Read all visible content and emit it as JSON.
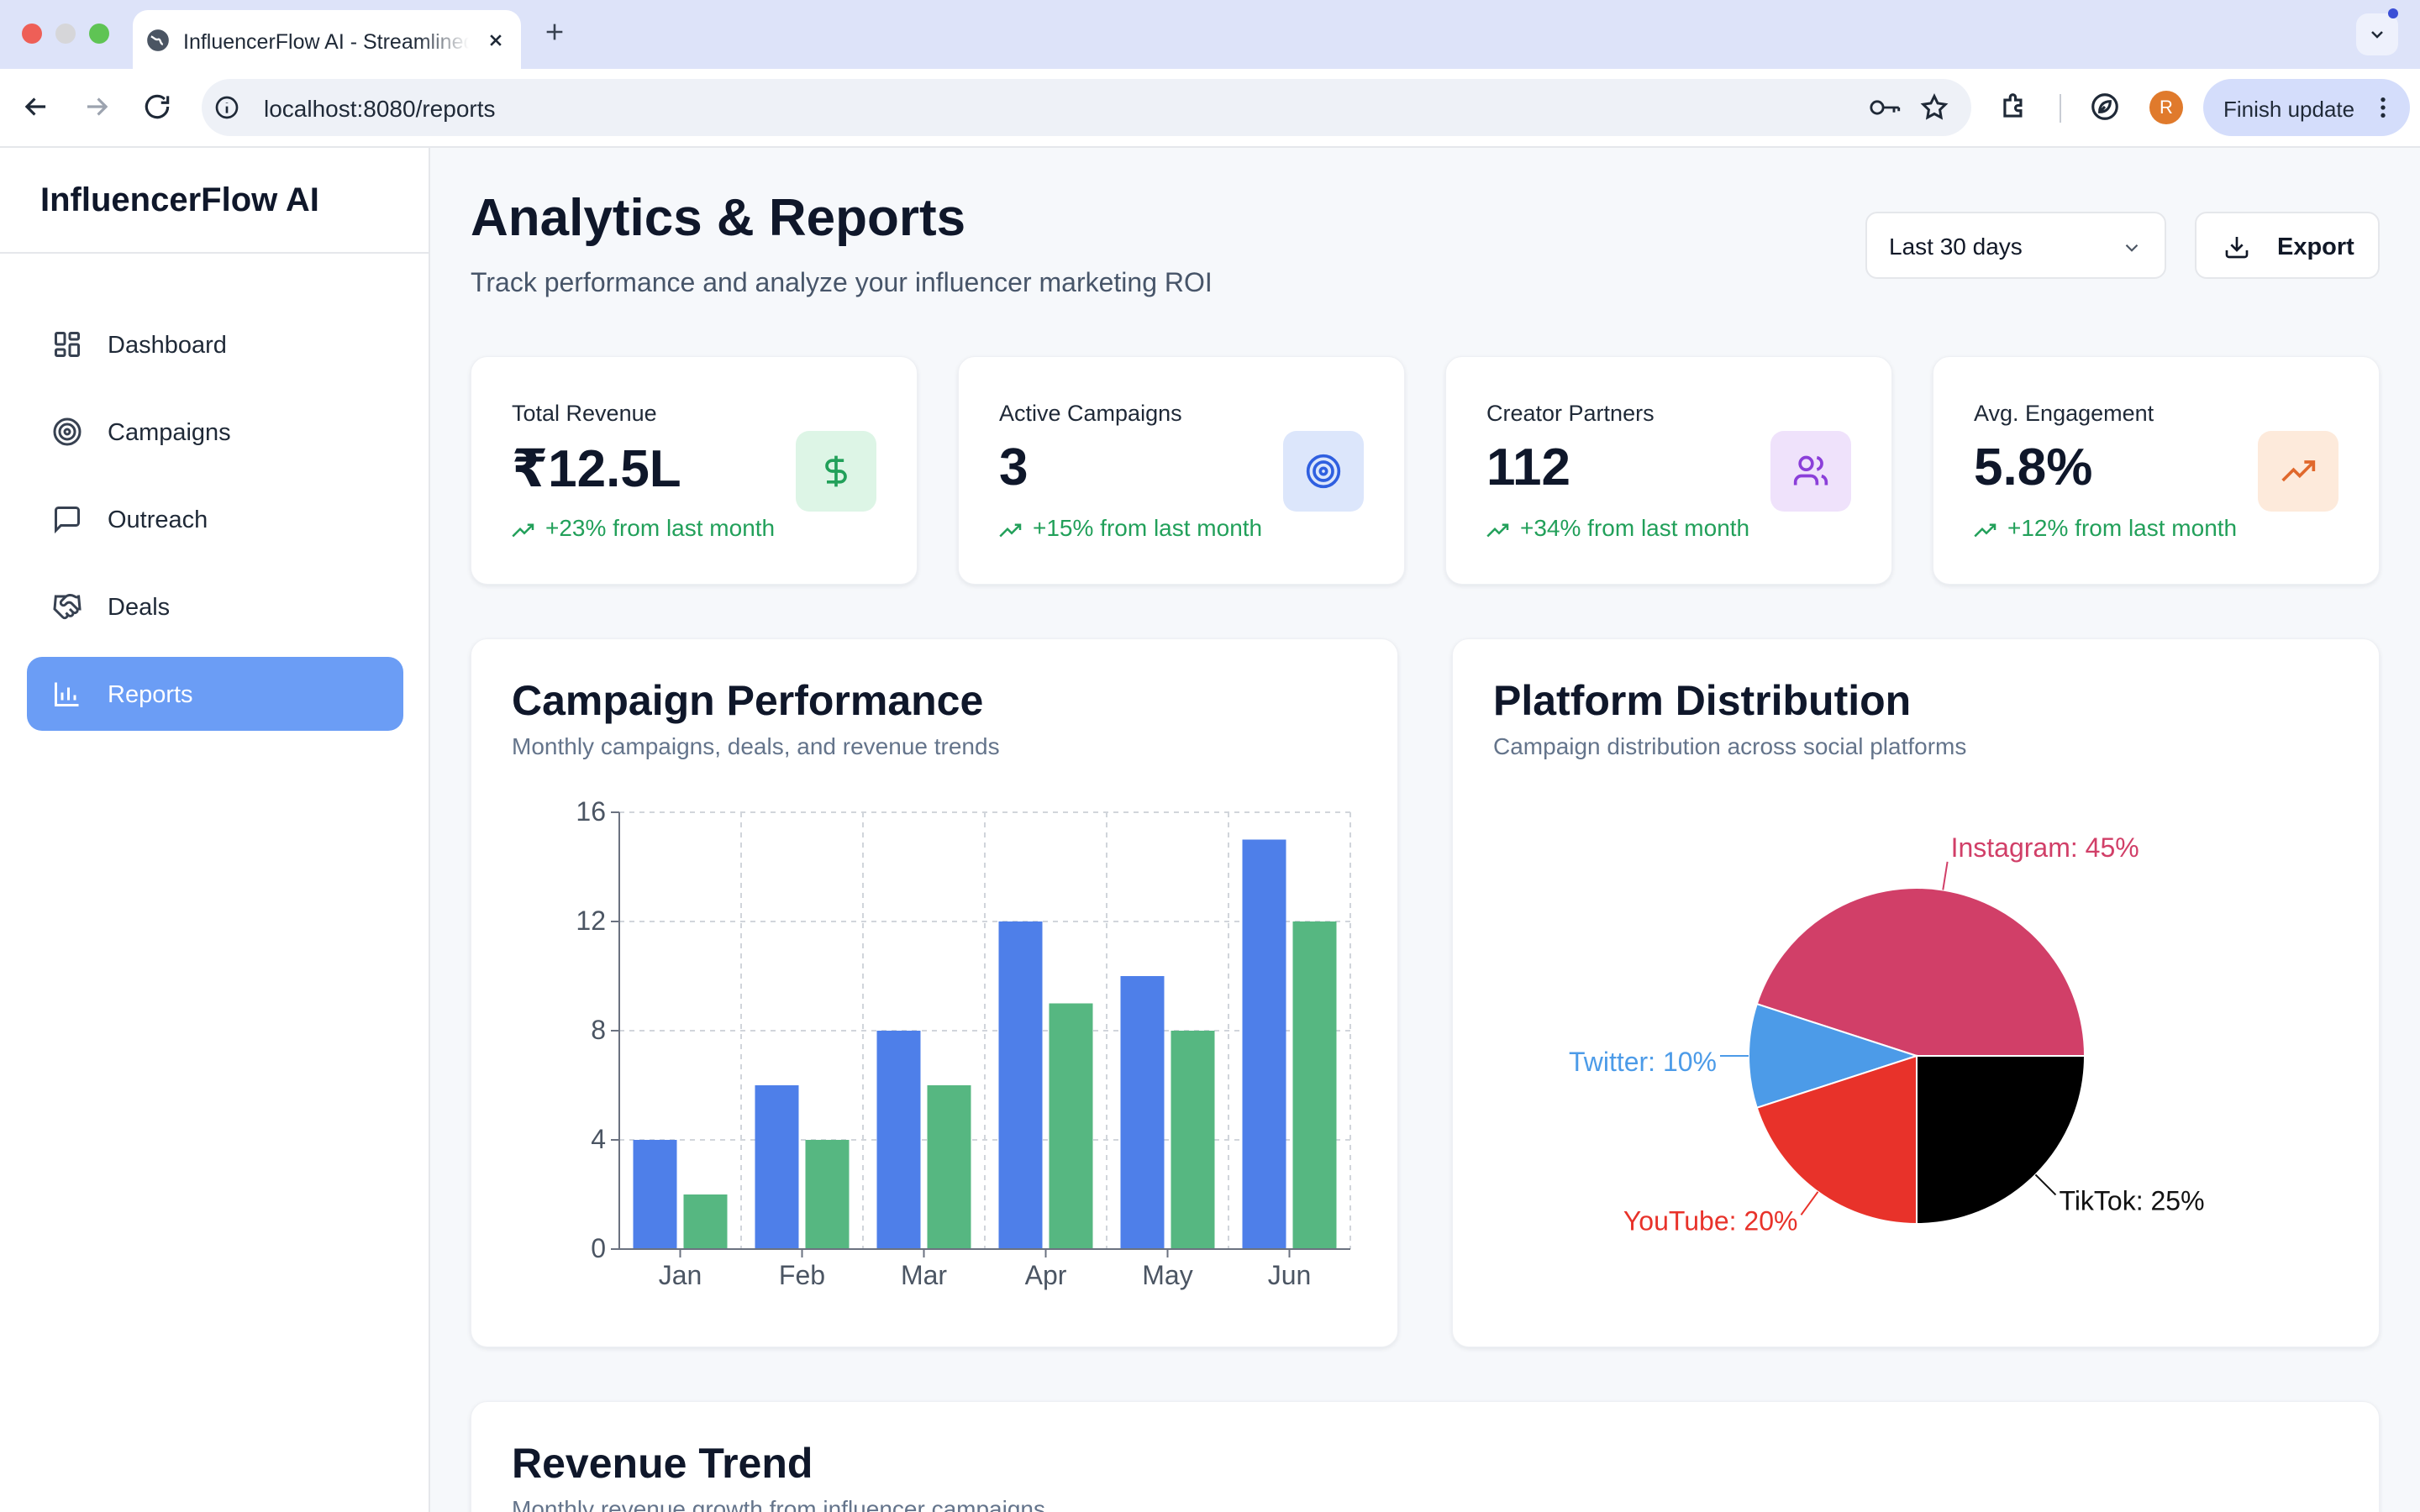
{
  "browser": {
    "tab_title": "InfluencerFlow AI - Streamlined Influencer Marketing",
    "url": "localhost:8080/reports",
    "profile_initial": "R",
    "finish_update": "Finish update"
  },
  "sidebar": {
    "brand": "InfluencerFlow AI",
    "items": [
      {
        "label": "Dashboard",
        "icon": "layout-grid-icon",
        "active": false
      },
      {
        "label": "Campaigns",
        "icon": "target-icon",
        "active": false
      },
      {
        "label": "Outreach",
        "icon": "message-square-icon",
        "active": false
      },
      {
        "label": "Deals",
        "icon": "handshake-icon",
        "active": false
      },
      {
        "label": "Reports",
        "icon": "bar-chart-icon",
        "active": true
      }
    ]
  },
  "header": {
    "title": "Analytics & Reports",
    "subtitle": "Track performance and analyze your influencer marketing ROI",
    "range": "Last 30 days",
    "export": "Export"
  },
  "stats": [
    {
      "label": "Total Revenue",
      "value": "₹12.5L",
      "change": "+23% from last month",
      "icon": "dollar-icon",
      "icon_color": "#22a05a",
      "icon_bg": "#ddf5e6"
    },
    {
      "label": "Active Campaigns",
      "value": "3",
      "change": "+15% from last month",
      "icon": "target-icon",
      "icon_color": "#2f5fe0",
      "icon_bg": "#dce6fb"
    },
    {
      "label": "Creator Partners",
      "value": "112",
      "change": "+34% from last month",
      "icon": "users-icon",
      "icon_color": "#8b3fd9",
      "icon_bg": "#efe2fb"
    },
    {
      "label": "Avg. Engagement",
      "value": "5.8%",
      "change": "+12% from last month",
      "icon": "trending-up-icon",
      "icon_color": "#e0682c",
      "icon_bg": "#fdeadb"
    }
  ],
  "campaign_performance": {
    "title": "Campaign Performance",
    "subtitle": "Monthly campaigns, deals, and revenue trends"
  },
  "platform_distribution": {
    "title": "Platform Distribution",
    "subtitle": "Campaign distribution across social platforms"
  },
  "revenue_trend": {
    "title": "Revenue Trend",
    "subtitle": "Monthly revenue growth from influencer campaigns"
  },
  "chart_data": [
    {
      "type": "bar",
      "title": "Campaign Performance",
      "categories": [
        "Jan",
        "Feb",
        "Mar",
        "Apr",
        "May",
        "Jun"
      ],
      "series": [
        {
          "values": [
            4,
            6,
            8,
            12,
            10,
            15
          ],
          "color": "#4e7fe9"
        },
        {
          "values": [
            2,
            4,
            6,
            9,
            8,
            12
          ],
          "color": "#56b781"
        }
      ],
      "ylim": [
        0,
        16
      ],
      "yticks": [
        0,
        4,
        8,
        12,
        16
      ],
      "grid": true
    },
    {
      "type": "pie",
      "title": "Platform Distribution",
      "slices": [
        {
          "label": "Instagram: 45%",
          "value": 45,
          "color": "#d13f68"
        },
        {
          "label": "Twitter: 10%",
          "value": 10,
          "color": "#4c9be8"
        },
        {
          "label": "YouTube: 20%",
          "value": 20,
          "color": "#e8322a"
        },
        {
          "label": "TikTok: 25%",
          "value": 25,
          "color": "#000000",
          "label_color": "#111111"
        }
      ]
    }
  ]
}
